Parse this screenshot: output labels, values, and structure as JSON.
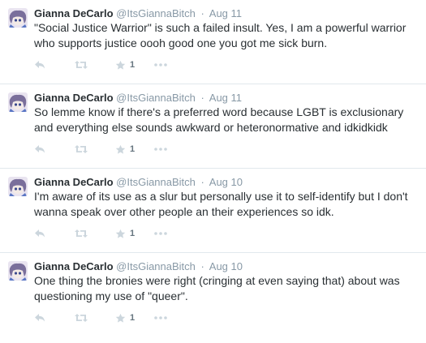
{
  "colors": {
    "text": "#292f33",
    "muted": "#8899a6",
    "icon": "#ccd6dd",
    "divider": "#e1e8ed"
  },
  "icons": {
    "reply": "reply-icon",
    "retweet": "retweet-icon",
    "favorite": "star-icon",
    "more": "more-icon"
  },
  "tweets": [
    {
      "fullname": "Gianna DeCarlo",
      "username": "@ItsGiannaBitch",
      "separator": "·",
      "time": "Aug 11",
      "text": "\"Social Justice Warrior\" is such a failed insult. Yes, I am a powerful warrior who supports justice oooh good one you got me sick burn.",
      "favorites": "1"
    },
    {
      "fullname": "Gianna DeCarlo",
      "username": "@ItsGiannaBitch",
      "separator": "·",
      "time": "Aug 11",
      "text": "So lemme know if there's a preferred word because LGBT is exclusionary and everything else sounds awkward or heteronormative and idkidkidk",
      "favorites": "1"
    },
    {
      "fullname": "Gianna DeCarlo",
      "username": "@ItsGiannaBitch",
      "separator": "·",
      "time": "Aug 10",
      "text": "I'm aware of its use as a slur but personally use it to self-identify but I don't wanna speak over other people an their experiences so idk.",
      "favorites": "1"
    },
    {
      "fullname": "Gianna DeCarlo",
      "username": "@ItsGiannaBitch",
      "separator": "·",
      "time": "Aug 10",
      "text": "One thing the bronies were right (cringing at even saying that) about was questioning my use of \"queer\".",
      "favorites": "1"
    }
  ]
}
